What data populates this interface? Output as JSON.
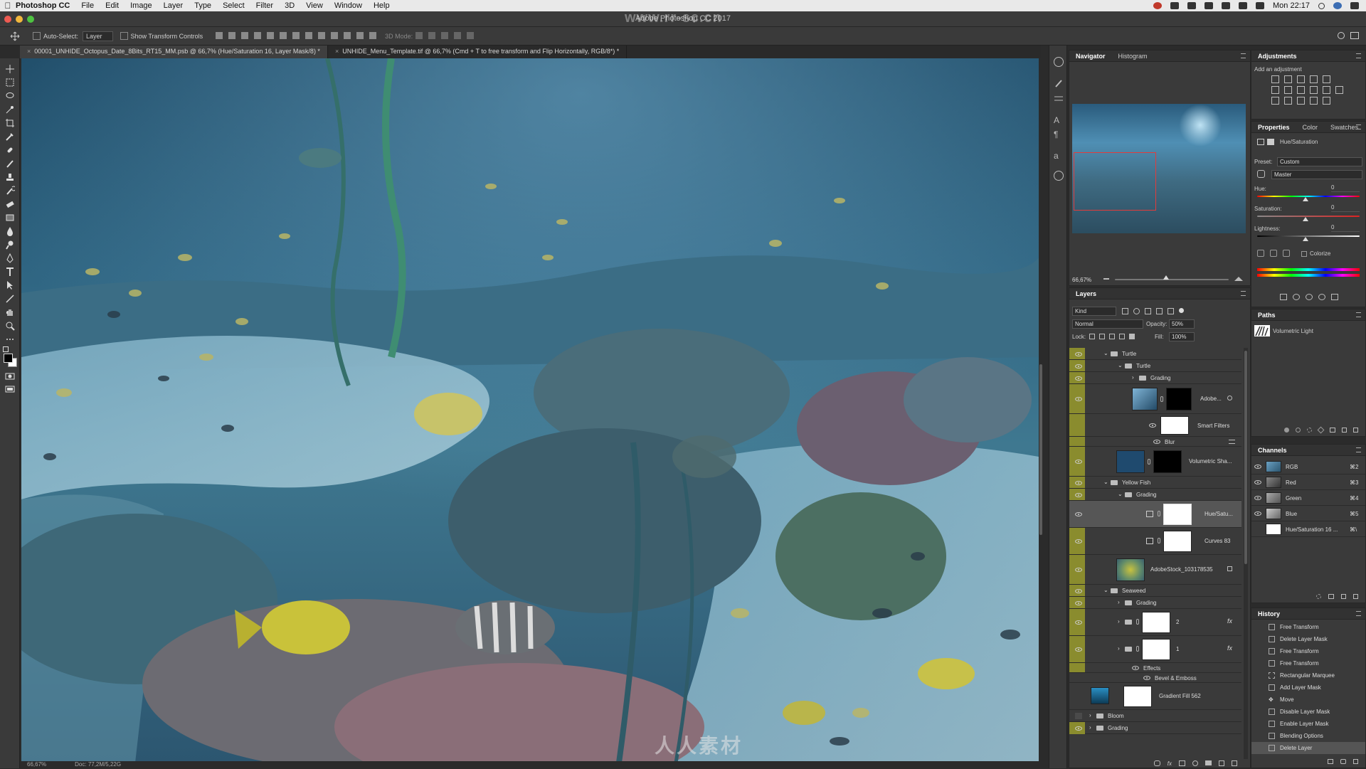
{
  "menubar": {
    "app_name": "Photoshop CC",
    "items": [
      "File",
      "Edit",
      "Image",
      "Layer",
      "Type",
      "Select",
      "Filter",
      "3D",
      "View",
      "Window",
      "Help"
    ],
    "clock": "Mon 22:17"
  },
  "window": {
    "title": "Adobe Photoshop CC 2017",
    "watermark": "www.rr-sc.cn"
  },
  "options_bar": {
    "auto_select_label": "Auto-Select:",
    "auto_select_value": "Layer",
    "transform_controls_label": "Show Transform Controls",
    "mode_3d_label": "3D Mode:"
  },
  "doc_tabs": [
    {
      "label": "00001_UNHIDE_Octopus_Date_8Bits_RT15_MM.psb @ 66,7% (Hue/Saturation 16, Layer Mask/8) *",
      "active": true
    },
    {
      "label": "UNHIDE_Menu_Template.tif @ 66,7% (Cmd + T to free transform and Flip Horizontally, RGB/8*) *",
      "active": false
    }
  ],
  "status": {
    "zoom": "66,67%",
    "doc": "Doc: 77,2M/5,22G"
  },
  "canvas_watermark": "人人素材",
  "navigator": {
    "tabs": [
      "Navigator",
      "Histogram"
    ],
    "zoom": "66,67%"
  },
  "adjustments": {
    "title": "Adjustments",
    "subtitle": "Add an adjustment"
  },
  "properties": {
    "tabs": [
      "Properties",
      "Color",
      "Swatches"
    ],
    "header": "Hue/Saturation",
    "preset_label": "Preset:",
    "preset_value": "Custom",
    "channel_value": "Master",
    "hue_label": "Hue:",
    "hue_value": "0",
    "saturation_label": "Saturation:",
    "saturation_value": "0",
    "lightness_label": "Lightness:",
    "lightness_value": "0",
    "colorize_label": "Colorize"
  },
  "layers_panel": {
    "title": "Layers",
    "filter_kind": "Kind",
    "blend_mode": "Normal",
    "opacity_label": "Opacity:",
    "opacity_value": "50%",
    "lock_label": "Lock:",
    "fill_label": "Fill:",
    "fill_value": "100%",
    "rows": {
      "turtle_group": "Turtle",
      "turtle_sub": "Turtle",
      "grading_1": "Grading",
      "adobe_layer": "Adobe...",
      "smart_filters": "Smart Filters",
      "blur": "Blur",
      "volumetric_sha": "Volumetric Sha...",
      "yellow_fish": "Yellow Fish",
      "grading_2": "Grading",
      "hue_satu": "Hue/Satu...",
      "curves": "Curves 83",
      "adobestock": "AdobeStock_103178535",
      "seaweed": "Seaweed",
      "grading_3": "Grading",
      "layer_2": "2",
      "layer_1": "1",
      "effects": "Effects",
      "bevel": "Bevel & Emboss",
      "gradient_fill": "Gradient Fill 562",
      "bloom": "Bloom",
      "grading_4": "Grading"
    }
  },
  "paths_panel": {
    "title": "Paths",
    "item": "Volumetric Light"
  },
  "channels_panel": {
    "title": "Channels",
    "rows": [
      {
        "name": "RGB",
        "shortcut": "⌘2"
      },
      {
        "name": "Red",
        "shortcut": "⌘3"
      },
      {
        "name": "Green",
        "shortcut": "⌘4"
      },
      {
        "name": "Blue",
        "shortcut": "⌘5"
      },
      {
        "name": "Hue/Saturation 16 ...",
        "shortcut": "⌘\\"
      }
    ]
  },
  "history_panel": {
    "title": "History",
    "items": [
      "Free Transform",
      "Delete Layer Mask",
      "Free Transform",
      "Free Transform",
      "Rectangular Marquee",
      "Add Layer Mask",
      "Move",
      "Disable Layer Mask",
      "Enable Layer Mask",
      "Blending Options",
      "Delete Layer"
    ]
  },
  "colors": {
    "accent": "#4a90d9",
    "visibility_column": "#8a8c2e",
    "panel_bg": "#3a3a3a"
  }
}
